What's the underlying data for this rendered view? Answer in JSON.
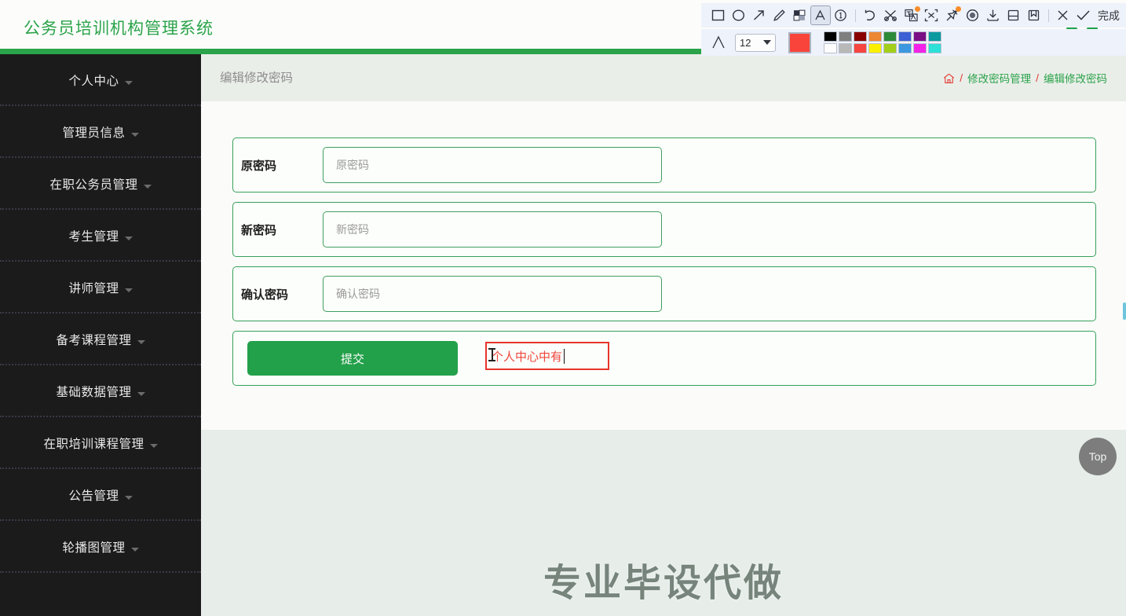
{
  "app": {
    "title": "公务员培训机构管理系统",
    "avatar_name": "user-avatar"
  },
  "sidebar": {
    "items": [
      {
        "label": "个人中心"
      },
      {
        "label": "管理员信息"
      },
      {
        "label": "在职公务员管理"
      },
      {
        "label": "考生管理"
      },
      {
        "label": "讲师管理"
      },
      {
        "label": "备考课程管理"
      },
      {
        "label": "基础数据管理"
      },
      {
        "label": "在职培训课程管理"
      },
      {
        "label": "公告管理"
      },
      {
        "label": "轮播图管理"
      }
    ]
  },
  "page": {
    "heading": "编辑修改密码",
    "breadcrumb": {
      "home_icon": "home-icon",
      "sep": "/",
      "items": [
        "修改密码管理",
        "编辑修改密码"
      ]
    }
  },
  "form": {
    "rows": [
      {
        "label": "原密码",
        "value": "",
        "placeholder": "原密码"
      },
      {
        "label": "新密码",
        "value": "",
        "placeholder": "新密码"
      },
      {
        "label": "确认密码",
        "value": "",
        "placeholder": "确认密码"
      }
    ],
    "submit_label": "提交"
  },
  "annotation": {
    "text": "个人中心中有",
    "color": "#f0463c",
    "border_color": "#e8342a"
  },
  "footer": {
    "watermark": "专业毕设代做",
    "top_button_label": "Top"
  },
  "screenshot_toolbar": {
    "tools": [
      {
        "name": "rectangle-icon",
        "selected": false,
        "badge": false
      },
      {
        "name": "ellipse-icon",
        "selected": false,
        "badge": false
      },
      {
        "name": "arrow-icon",
        "selected": false,
        "badge": false
      },
      {
        "name": "pen-icon",
        "selected": false,
        "badge": false
      },
      {
        "name": "mosaic-icon",
        "selected": false,
        "badge": false
      },
      {
        "name": "text-icon",
        "selected": true,
        "badge": false
      },
      {
        "name": "numbered-marker-icon",
        "selected": false,
        "badge": false
      },
      {
        "name": "divider",
        "selected": false,
        "badge": false
      },
      {
        "name": "undo-icon",
        "selected": false,
        "badge": false
      },
      {
        "name": "cut-icon",
        "selected": false,
        "badge": false
      },
      {
        "name": "translate-icon",
        "selected": false,
        "badge": true
      },
      {
        "name": "ocr-extract-icon",
        "selected": false,
        "badge": false
      },
      {
        "name": "pin-icon",
        "selected": false,
        "badge": true
      },
      {
        "name": "record-icon",
        "selected": false,
        "badge": false
      },
      {
        "name": "download-icon",
        "selected": false,
        "badge": false
      },
      {
        "name": "save-icon",
        "selected": false,
        "badge": false
      },
      {
        "name": "bookmark-icon",
        "selected": false,
        "badge": false
      },
      {
        "name": "divider",
        "selected": false,
        "badge": false
      },
      {
        "name": "close-icon",
        "selected": false,
        "badge": false
      },
      {
        "name": "check-icon",
        "selected": false,
        "badge": false
      }
    ],
    "done_label": "完成",
    "font_size": "12",
    "current_color": "#f8443a",
    "palette_row1": [
      "#000000",
      "#7f7f7f",
      "#880000",
      "#ed8733",
      "#2d8a38",
      "#3b5fd4",
      "#7b0f86",
      "#0a9aa0"
    ],
    "palette_row2": [
      "#fdfdfd",
      "#b8b8b8",
      "#f74540",
      "#fbf000",
      "#a3cf1a",
      "#3b98e0",
      "#f422e8",
      "#2de0d8"
    ]
  }
}
